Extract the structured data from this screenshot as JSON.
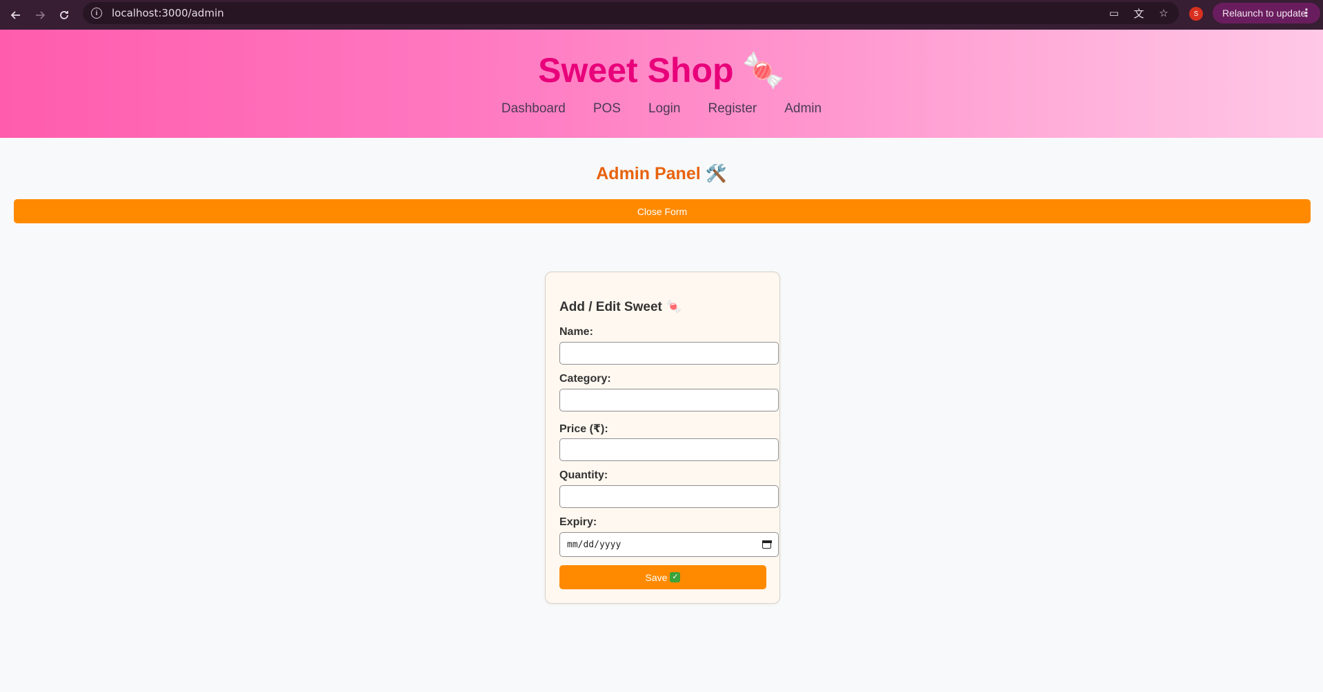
{
  "browser": {
    "url": "localhost:3000/admin",
    "profile_initial": "S",
    "relaunch_label": "Relaunch to update"
  },
  "header": {
    "brand": "Sweet Shop",
    "brand_emoji": "🍬",
    "nav": [
      "Dashboard",
      "POS",
      "Login",
      "Register",
      "Admin"
    ]
  },
  "page": {
    "title": "Admin Panel 🛠️",
    "close_form_label": "Close Form"
  },
  "form": {
    "heading": "Add / Edit Sweet 🍬",
    "name_label": "Name:",
    "category_label": "Category:",
    "price_label": "Price (₹):",
    "quantity_label": "Quantity:",
    "expiry_label": "Expiry:",
    "expiry_placeholder": "mm/dd/yyyy",
    "save_label": "Save"
  }
}
